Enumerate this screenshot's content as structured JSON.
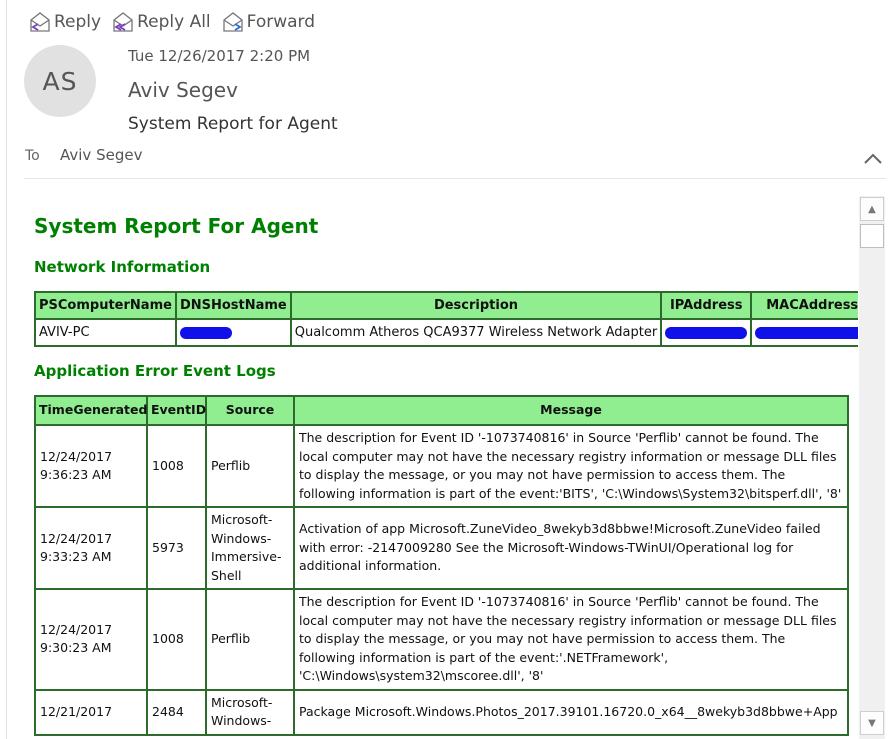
{
  "toolbar": {
    "reply_label": "Reply",
    "reply_all_label": "Reply All",
    "forward_label": "Forward"
  },
  "header": {
    "avatar_initials": "AS",
    "date": "Tue 12/26/2017 2:20 PM",
    "sender": "Aviv Segev",
    "subject": "System Report for Agent",
    "to_label": "To",
    "to_value": "Aviv Segev"
  },
  "report": {
    "title": "System Report For Agent",
    "network_heading": "Network Information",
    "network_columns": [
      "PSComputerName",
      "DNSHostName",
      "Description",
      "IPAddress",
      "MACAddress"
    ],
    "network_rows": [
      {
        "computer": "AVIV-PC",
        "description": "Qualcomm Atheros QCA9377 Wireless Network Adapter"
      }
    ],
    "events_heading": "Application Error Event Logs",
    "event_columns": [
      "TimeGenerated",
      "EventID",
      "Source",
      "Message"
    ],
    "event_rows": [
      {
        "time": "12/24/2017 9:36:23 AM",
        "id": "1008",
        "source": "Perflib",
        "message": "The description for Event ID '-1073740816' in Source 'Perflib' cannot be found. The local computer may not have the necessary registry information or message DLL files to display the message, or you may not have permission to access them. The following information is part of the event:'BITS', 'C:\\Windows\\System32\\bitsperf.dll', '8'"
      },
      {
        "time": "12/24/2017 9:33:23 AM",
        "id": "5973",
        "source": "Microsoft-Windows-Immersive-Shell",
        "message": "Activation of app Microsoft.ZuneVideo_8wekyb3d8bbwe!Microsoft.ZuneVideo failed with error: -2147009280 See the Microsoft-Windows-TWinUI/Operational log for additional information."
      },
      {
        "time": "12/24/2017 9:30:23 AM",
        "id": "1008",
        "source": "Perflib",
        "message": "The description for Event ID '-1073740816' in Source 'Perflib' cannot be found. The local computer may not have the necessary registry information or message DLL files to display the message, or you may not have permission to access them. The following information is part of the event:'.NETFramework', 'C:\\Windows\\system32\\mscoree.dll', '8'"
      },
      {
        "time": "12/21/2017",
        "id": "2484",
        "source": "Microsoft-Windows-",
        "message": "Package Microsoft.Windows.Photos_2017.39101.16720.0_x64__8wekyb3d8bbwe+App"
      }
    ]
  },
  "colors": {
    "heading_green": "#008000",
    "table_header_bg": "#90ee90",
    "table_border": "#2c6b2c",
    "redaction": "#1010e8"
  },
  "icons": {
    "reply": "reply-icon",
    "reply_all": "reply-all-icon",
    "forward": "forward-icon",
    "collapse": "chevron-up-icon"
  }
}
